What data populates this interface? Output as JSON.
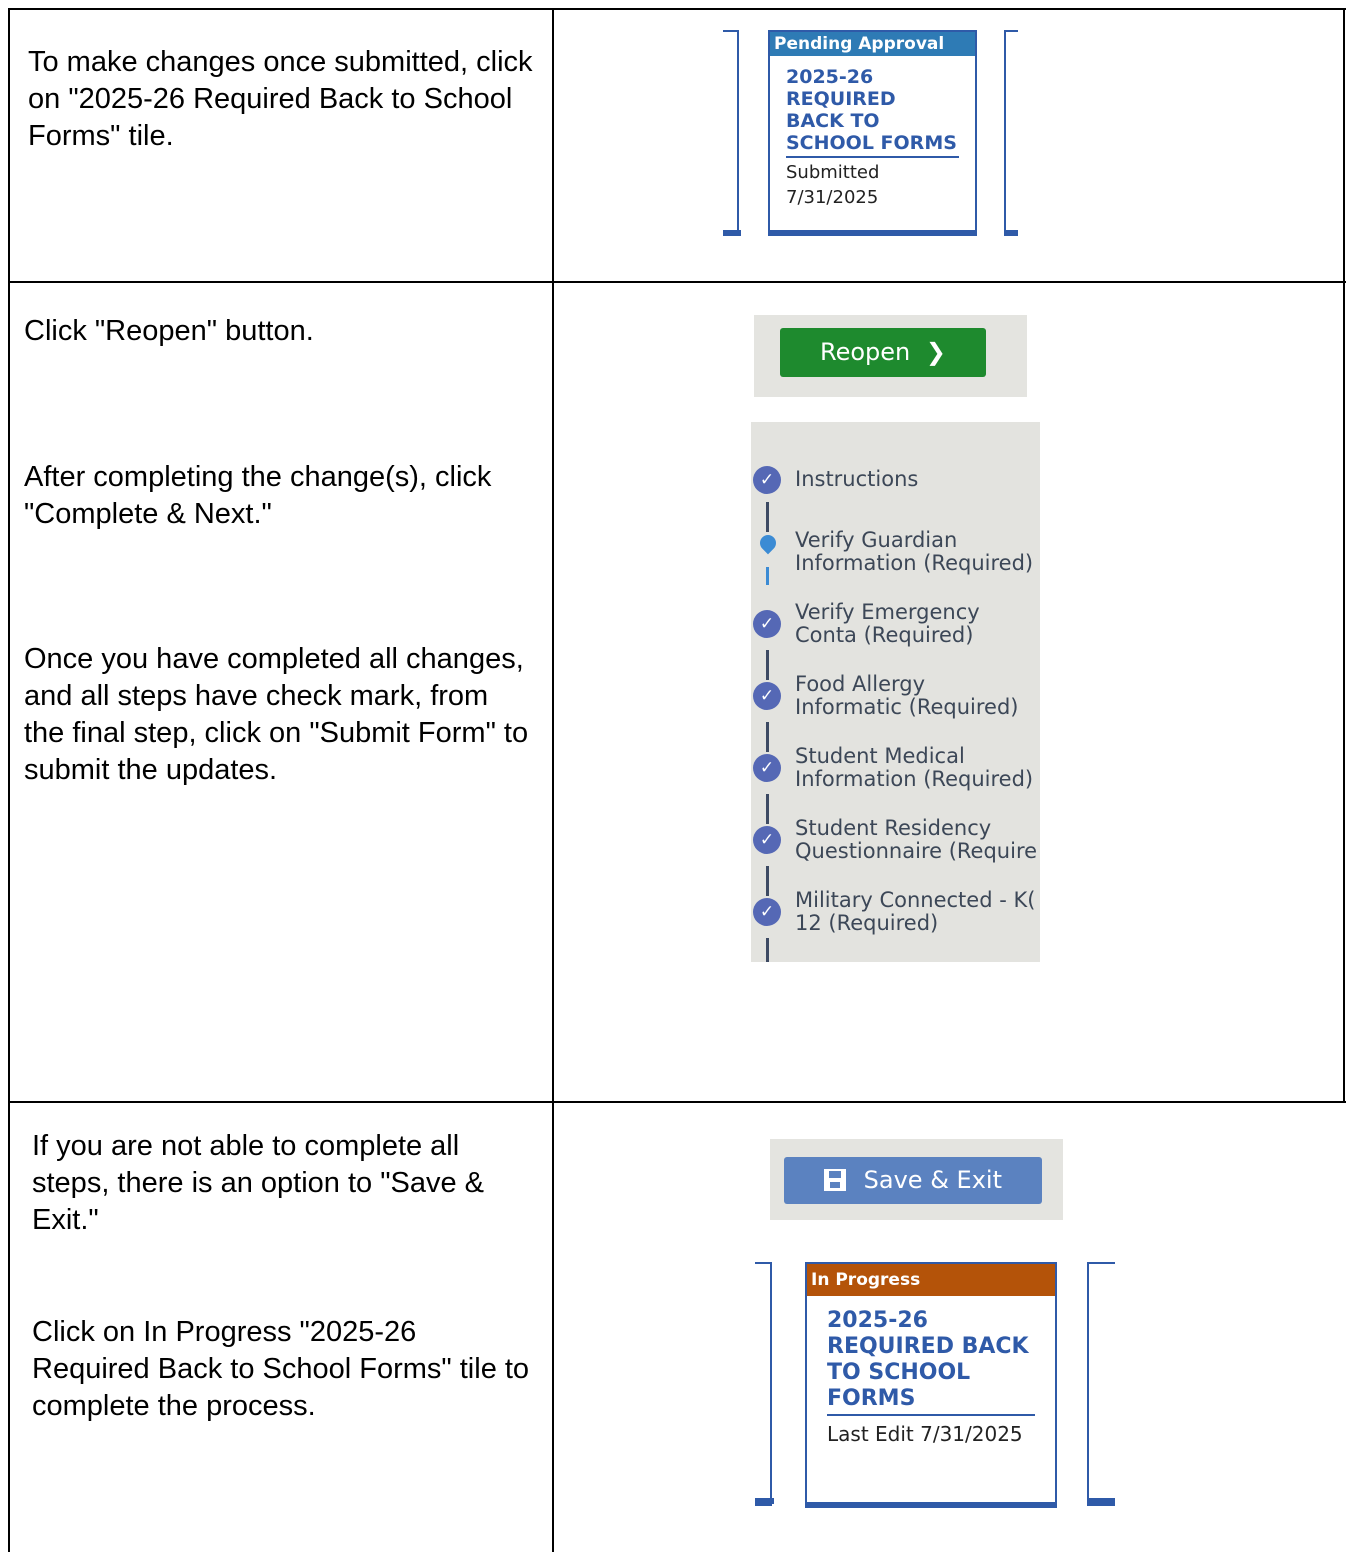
{
  "rows": [
    {
      "text": "To make changes once submitted, click on \"2025-26 Required Back to School Forms\" tile.",
      "tile": {
        "status": "Pending Approval",
        "status_color": "#2e7bb5",
        "title": "2025-26 REQUIRED BACK TO SCHOOL FORMS",
        "line1": "Submitted",
        "line2": "7/31/2025"
      }
    },
    {
      "text_reopen": "Click \"Reopen\" button.",
      "text_complete": "After completing the change(s), click \"Complete & Next.\"",
      "text_submit": "Once you have completed all changes, and all steps have check mark, from the final step, click on \"Submit Form\" to submit the updates.",
      "reopen_button": {
        "label": "Reopen",
        "icon": "chevron-right-icon",
        "color": "#1e8a2e"
      },
      "steps": [
        {
          "label": "Instructions",
          "status": "complete"
        },
        {
          "label": "Verify Guardian Information (Required)",
          "status": "current"
        },
        {
          "label": "Verify Emergency Conta (Required)",
          "status": "complete"
        },
        {
          "label": "Food Allergy Informatic (Required)",
          "status": "complete"
        },
        {
          "label": "Student Medical Information (Required)",
          "status": "complete"
        },
        {
          "label": "Student Residency Questionnaire (Require",
          "status": "complete"
        },
        {
          "label": "Military Connected - K( 12 (Required)",
          "status": "complete"
        }
      ]
    },
    {
      "text_save": "If you are not able to complete all steps, there is an option to \"Save & Exit.\"",
      "text_click": "Click on In Progress \"2025-26 Required Back to School Forms\" tile to complete the process.",
      "save_button": {
        "label": "Save & Exit",
        "icon": "save-icon",
        "color": "#5b82c0"
      },
      "tile": {
        "status": "In Progress",
        "status_color": "#b45309",
        "title": "2025-26 REQUIRED BACK TO SCHOOL FORMS",
        "line1": "Last Edit 7/31/2025"
      }
    }
  ]
}
